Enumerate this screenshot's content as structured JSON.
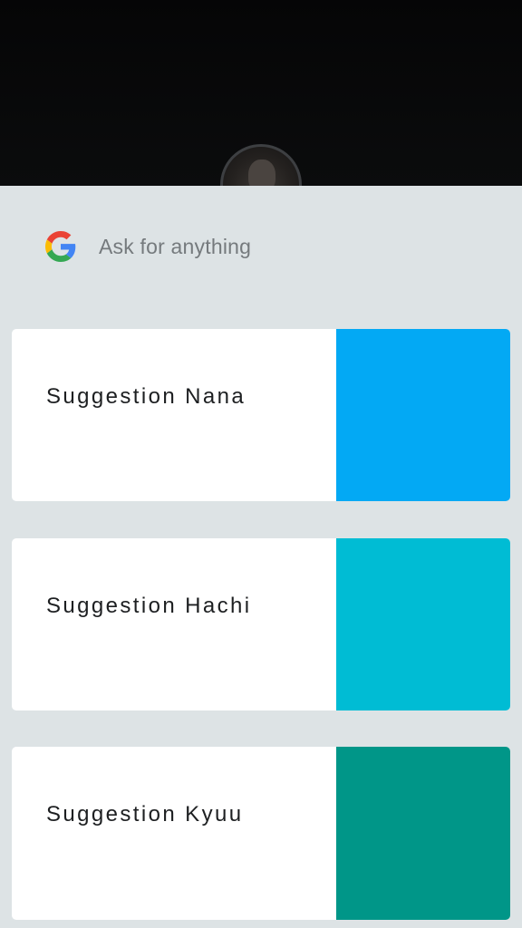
{
  "search": {
    "placeholder": "Ask for anything"
  },
  "suggestions": [
    {
      "label": "Suggestion Nana",
      "color": "#03a9f4"
    },
    {
      "label": "Suggestion Hachi",
      "color": "#00bcd4"
    },
    {
      "label": "Suggestion Kyuu",
      "color": "#009688"
    }
  ],
  "icons": {
    "search_logo": "google-g-icon",
    "avatar": "user-avatar"
  }
}
